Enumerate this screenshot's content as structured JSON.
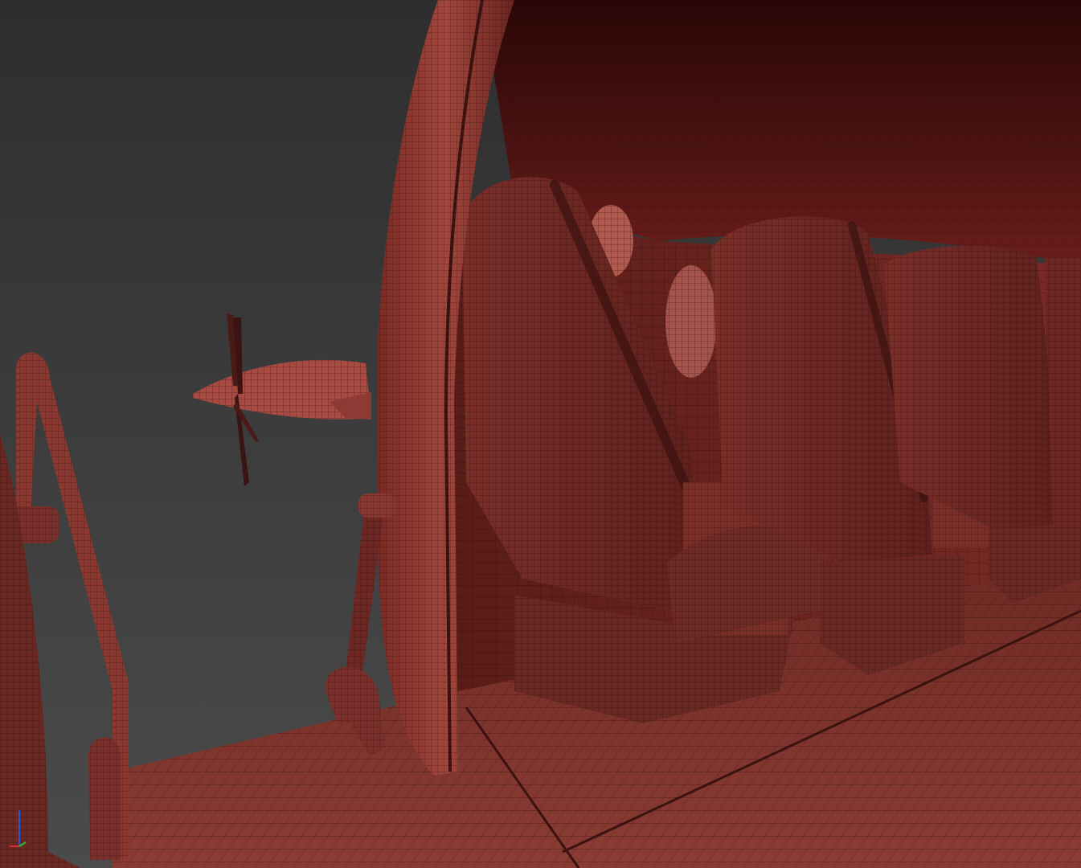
{
  "viewport": {
    "background_top": "#2f2f2f",
    "background_bottom": "#4a4a4a",
    "mesh_base_color": "#8a3a34",
    "mesh_dark_color": "#4a1a17",
    "mesh_light_color": "#b8554c",
    "wire_color": "#2a0e0c",
    "shading_mode": "wireframe-on-shaded",
    "scene_objects": [
      "door-frame",
      "entry-stair-handrail",
      "door-support-strut",
      "engine-nacelle",
      "propeller",
      "cabin-ceiling",
      "cabin-wall",
      "cabin-window",
      "passenger-seat",
      "cabin-floor"
    ]
  },
  "axis_gizmo": {
    "x_color": "#d93030",
    "y_color": "#30c030",
    "z_color": "#3050e0"
  }
}
